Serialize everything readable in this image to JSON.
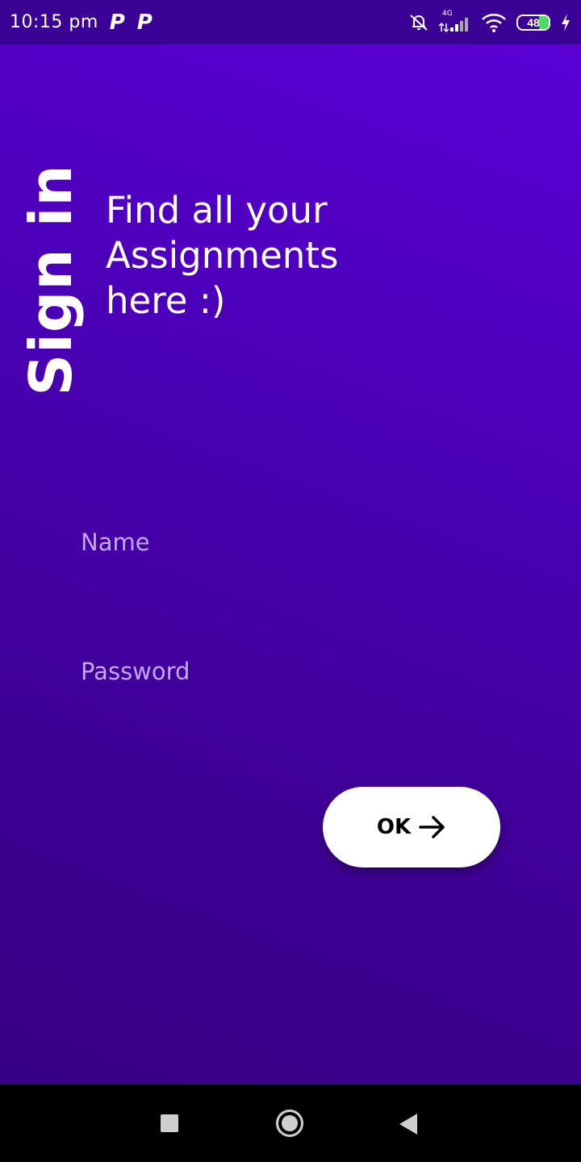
{
  "status_bar": {
    "time": "10:15 pm",
    "notification_icons": [
      "p-app-icon",
      "p-app-icon"
    ],
    "network_label": "4G",
    "battery": "48",
    "icons": [
      "alarm-off-icon",
      "signal-icon",
      "wifi-icon",
      "battery-icon",
      "charging-icon"
    ]
  },
  "screen": {
    "title": "Sign in",
    "tagline": "Find all your Assignments here :)",
    "name_placeholder": "Name",
    "password_placeholder": "Password",
    "ok_label": "OK"
  },
  "nav": {
    "icons": [
      "recents-icon",
      "home-icon",
      "back-icon"
    ]
  },
  "colors": {
    "background_top": "#5a00d6",
    "background_bottom": "#380084",
    "status_bar": "#3a0396",
    "placeholder": "#c2a8ef",
    "button": "#ffffff"
  }
}
